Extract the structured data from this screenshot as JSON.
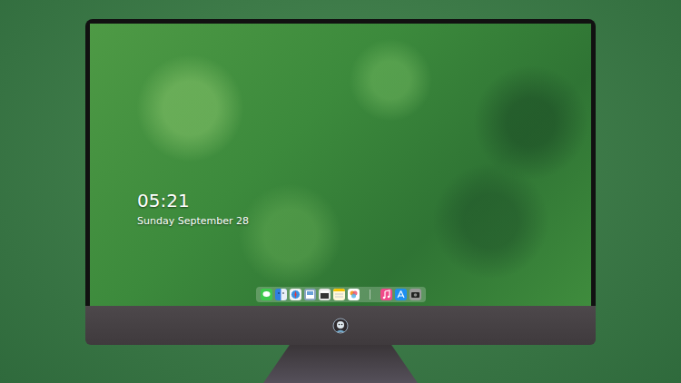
{
  "lock_screen": {
    "time": "05:21",
    "date": "Sunday September 28"
  },
  "dock": {
    "items": [
      {
        "kind": "messages"
      },
      {
        "kind": "finder"
      },
      {
        "kind": "safari"
      },
      {
        "kind": "preview"
      },
      {
        "kind": "video"
      },
      {
        "kind": "notes"
      },
      {
        "kind": "photos"
      },
      {
        "kind": "separator"
      },
      {
        "kind": "music"
      },
      {
        "kind": "appstore"
      },
      {
        "kind": "camera"
      }
    ]
  }
}
